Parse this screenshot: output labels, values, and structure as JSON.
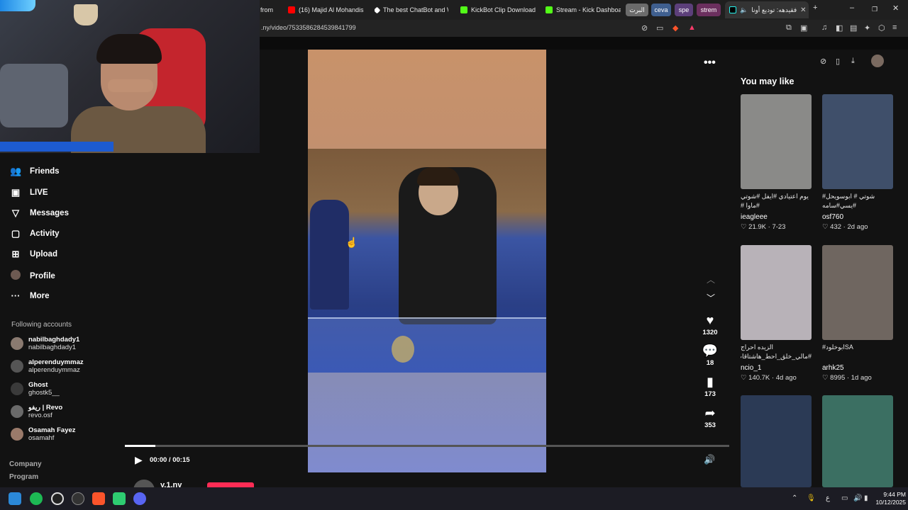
{
  "browser": {
    "tabs": [
      {
        "label": "from"
      },
      {
        "label": "(16) Majid Al Mohandis"
      },
      {
        "label": "The best ChatBot and W"
      },
      {
        "label": "KickBot Clip Downloader"
      },
      {
        "label": "Stream - Kick Dashboard"
      }
    ],
    "pills": [
      {
        "label": "البرت",
        "color": "#6b6b6b"
      },
      {
        "label": "ceva",
        "color": "#3f5f8f"
      },
      {
        "label": "spe",
        "color": "#5c3f7a"
      },
      {
        "label": "strem",
        "color": "#6b2f5e"
      }
    ],
    "active_tab": {
      "label": "فقيدهه: توديع أونا"
    },
    "url": ".ny/video/7533586284539841799"
  },
  "sidebar": {
    "items": [
      {
        "label": "Friends"
      },
      {
        "label": "LIVE"
      },
      {
        "label": "Messages"
      },
      {
        "label": "Activity"
      },
      {
        "label": "Upload"
      },
      {
        "label": "Profile"
      },
      {
        "label": "More"
      }
    ],
    "following_header": "Following accounts",
    "accounts": [
      {
        "name": "nabilbaghdady1",
        "handle": "nabilbaghdady1"
      },
      {
        "name": "alperenduymmaz",
        "handle": "alperenduymmaz"
      },
      {
        "name": "Ghost",
        "handle": "ghostk5__"
      },
      {
        "name": "ريفو | Revo",
        "handle": "revo.osf"
      },
      {
        "name": "Osamah Fayez",
        "handle": "osamahf"
      }
    ],
    "footer": [
      "Company",
      "Program"
    ]
  },
  "player": {
    "time": "00:00 / 00:15",
    "progress": 0.05,
    "likes": "1320",
    "comments": "18",
    "saves": "173",
    "shares": "353",
    "author": "y.1.ny"
  },
  "recommendations": {
    "heading": "You may like",
    "cards": [
      {
        "title": "يوم اعتيادي #ايفل #شوتي #ماوا #",
        "user": "ieagleee",
        "likes": "21.9K",
        "date": "7-23",
        "color": "#8a8a88"
      },
      {
        "title": "شوتي # ابوسويحل# #يسي#سامه",
        "user": "osf760",
        "likes": "432",
        "date": "2d ago",
        "color": "#3f4f6a"
      },
      {
        "title": "الزيده احراج #مالي_خلق_احط_هاشتاقات",
        "user": "ncio_1",
        "likes": "140.7K",
        "date": "4d ago",
        "color": "#b8b2b8"
      },
      {
        "title": "SAابوخلود#",
        "user": "arhk25",
        "likes": "8995",
        "date": "1d ago",
        "color": "#6f6660"
      },
      {
        "title": "",
        "user": "",
        "likes": "",
        "date": "",
        "color": "#2b3a55"
      },
      {
        "title": "",
        "user": "",
        "likes": "",
        "date": "",
        "color": "#3b6f62"
      }
    ]
  },
  "taskbar": {
    "time": "9:44 PM",
    "date": "10/12/2025",
    "lang": "ع"
  }
}
